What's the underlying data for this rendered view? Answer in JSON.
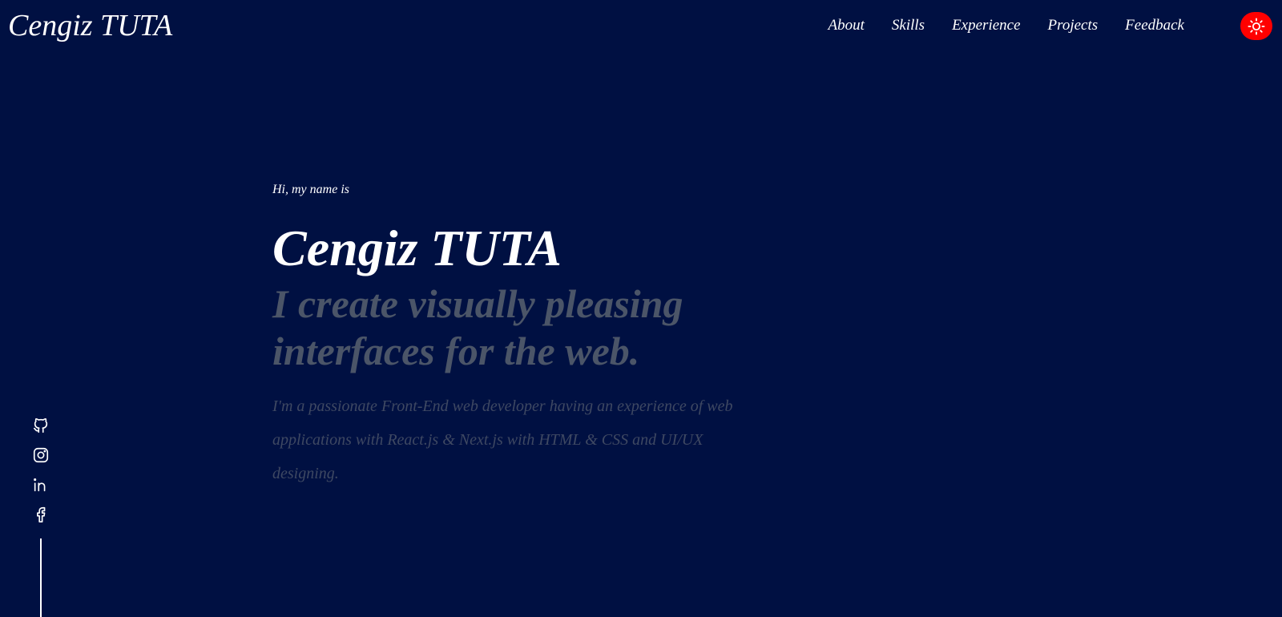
{
  "header": {
    "brand": "Cengiz TUTA",
    "nav": [
      {
        "label": "About"
      },
      {
        "label": "Skills"
      },
      {
        "label": "Experience"
      },
      {
        "label": "Projects"
      },
      {
        "label": "Feedback"
      }
    ],
    "theme_toggle_icon": "sun-icon",
    "theme_toggle_color": "#ff0000"
  },
  "hero": {
    "greeting": "Hi, my name is",
    "name": "Cengiz TUTA",
    "tagline": "I create visually pleasing interfaces for the web.",
    "description": "I'm a passionate Front-End web developer having an experience of web applications with React.js & Next.js with HTML & CSS and UI/UX designing."
  },
  "social": {
    "icons": [
      "github-icon",
      "instagram-icon",
      "linkedin-icon",
      "facebook-icon"
    ]
  },
  "colors": {
    "background": "#001042",
    "text": "#ffffff",
    "tagline": "#4b5568",
    "description": "#3e4862",
    "accent": "#ff0000"
  }
}
